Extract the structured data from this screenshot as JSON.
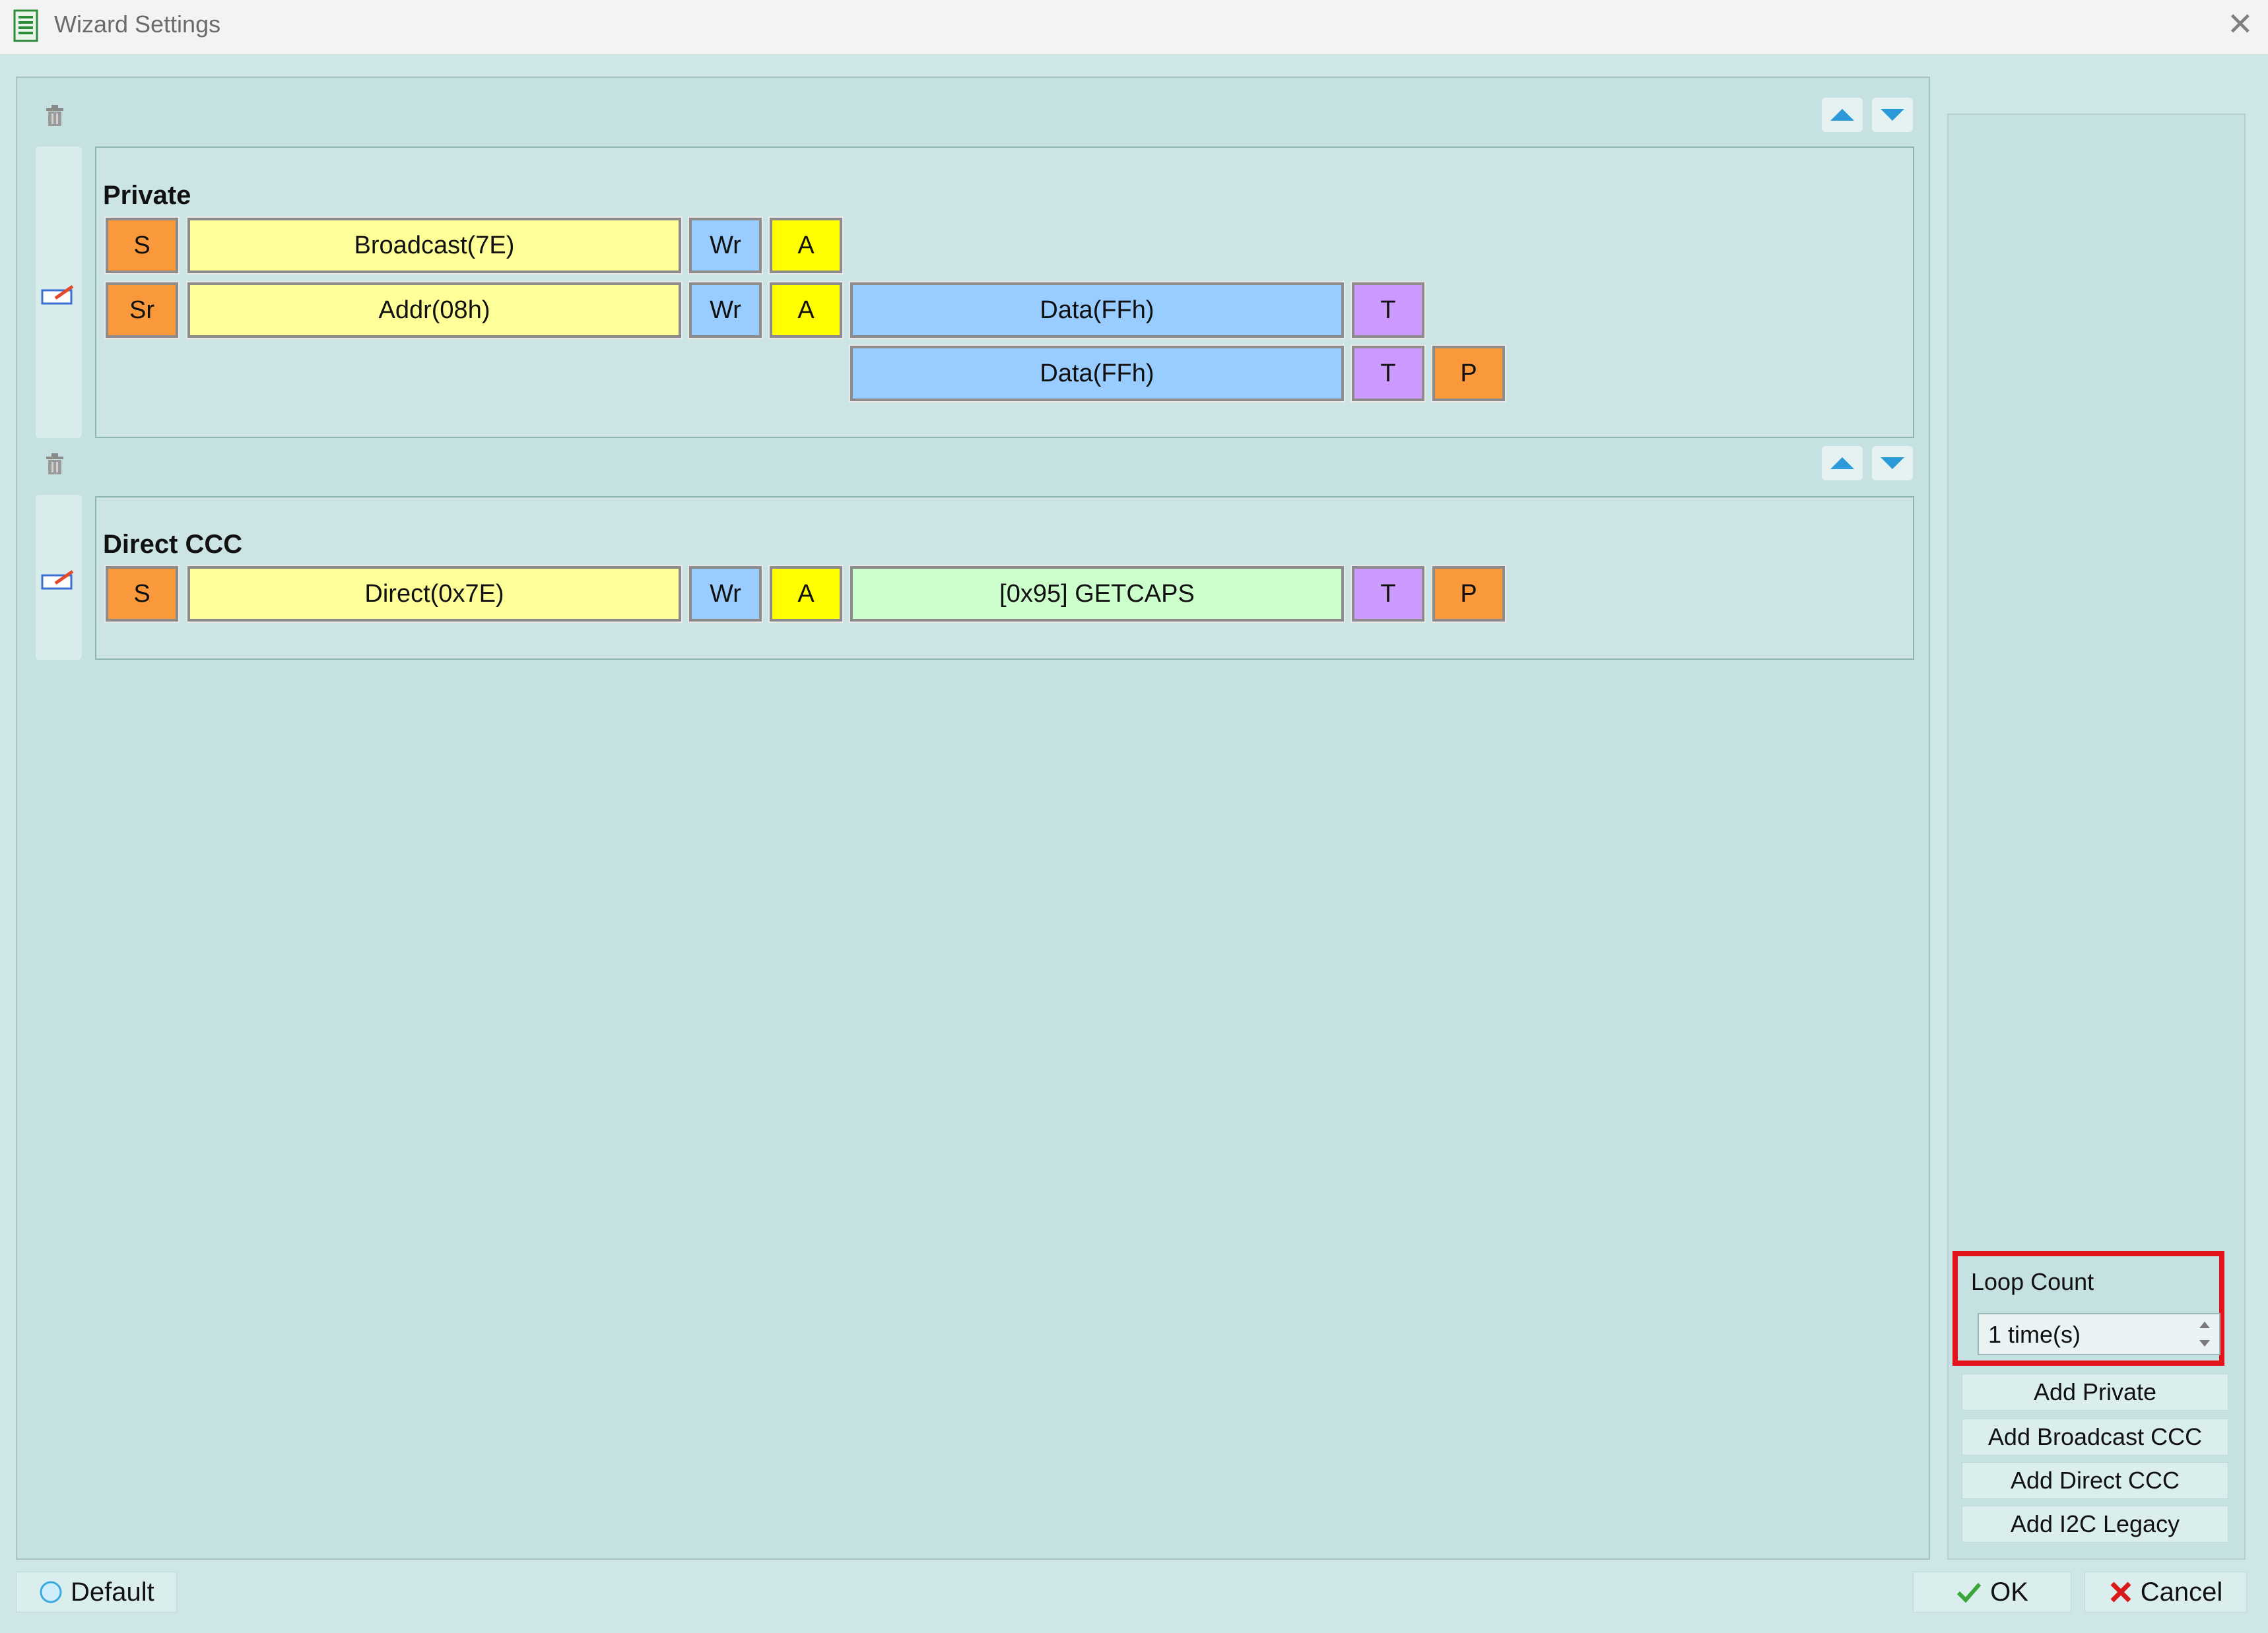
{
  "window": {
    "title": "Wizard Settings",
    "close_icon": "close-icon"
  },
  "blocks": [
    {
      "title": "Private",
      "rows": [
        [
          "S",
          "Broadcast(7E)",
          "Wr",
          "A"
        ],
        [
          "Sr",
          "Addr(08h)",
          "Wr",
          "A",
          "Data(FFh)",
          "T"
        ],
        [
          "Data(FFh)",
          "T",
          "P"
        ]
      ]
    },
    {
      "title": "Direct CCC",
      "rows": [
        [
          "S",
          "Direct(0x7E)",
          "Wr",
          "A",
          "[0x95] GETCAPS",
          "T",
          "P"
        ]
      ]
    }
  ],
  "loop_count": {
    "label": "Loop Count",
    "value": "1 time(s)"
  },
  "side_buttons": {
    "add_private": "Add Private",
    "add_broadcast_ccc": "Add Broadcast CCC",
    "add_direct_ccc": "Add Direct CCC",
    "add_i2c_legacy": "Add I2C Legacy"
  },
  "bottom": {
    "default_label": "Default",
    "ok_label": "OK",
    "cancel_label": "Cancel"
  },
  "colors": {
    "orange": "#f9993c",
    "light_yellow": "#ffff99",
    "blue": "#99ccff",
    "yellow": "#ffff00",
    "purple": "#cc99ff",
    "green": "#ccffcc",
    "highlight": "#e3141b"
  }
}
